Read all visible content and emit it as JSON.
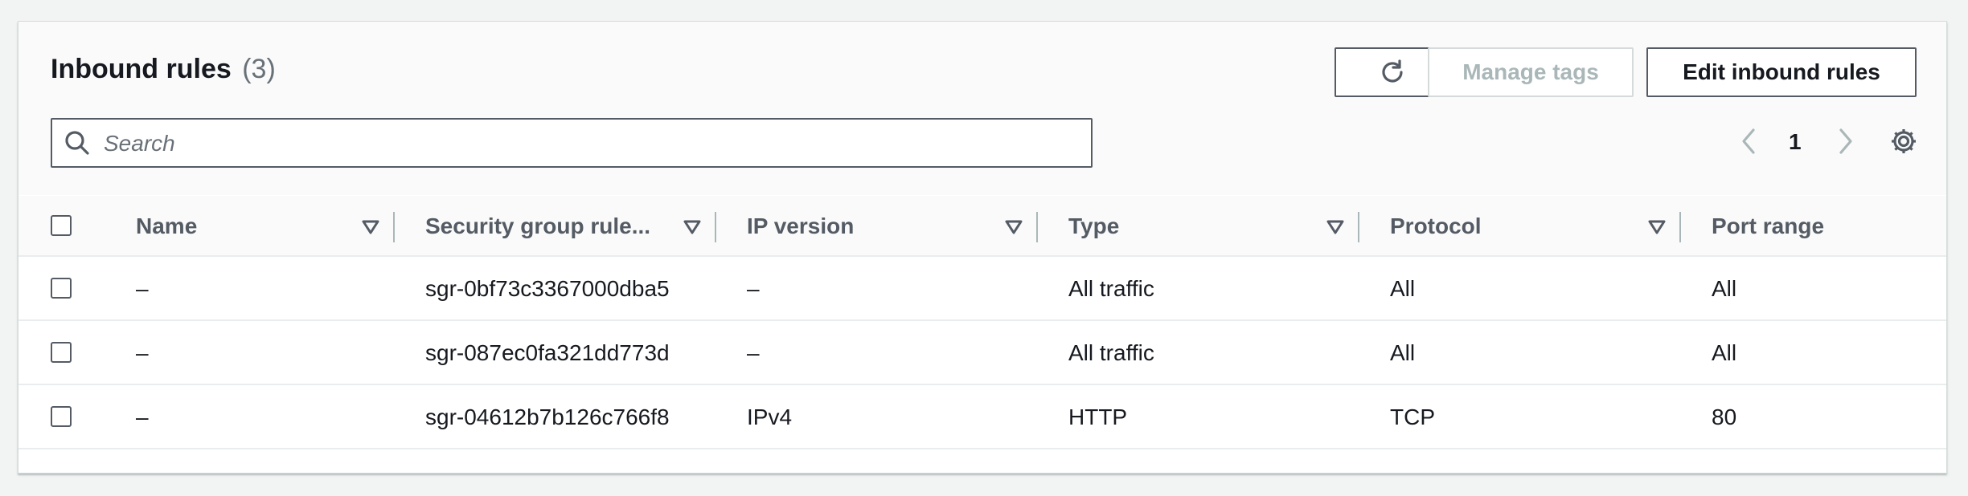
{
  "header": {
    "title": "Inbound rules",
    "count": "(3)",
    "buttons": {
      "manage_tags": "Manage tags",
      "edit_inbound_rules": "Edit inbound rules"
    }
  },
  "search": {
    "placeholder": "Search",
    "value": ""
  },
  "pagination": {
    "current_page": "1"
  },
  "table": {
    "columns": [
      "Name",
      "Security group rule...",
      "IP version",
      "Type",
      "Protocol",
      "Port range"
    ],
    "rows": [
      {
        "name": "–",
        "rule_id": "sgr-0bf73c3367000dba5",
        "ip_version": "–",
        "type": "All traffic",
        "protocol": "All",
        "port_range": "All"
      },
      {
        "name": "–",
        "rule_id": "sgr-087ec0fa321dd773d",
        "ip_version": "–",
        "type": "All traffic",
        "protocol": "All",
        "port_range": "All"
      },
      {
        "name": "–",
        "rule_id": "sgr-04612b7b126c766f8",
        "ip_version": "IPv4",
        "type": "HTTP",
        "protocol": "TCP",
        "port_range": "80"
      }
    ]
  },
  "icons": {
    "refresh": "refresh-icon",
    "search": "search-icon",
    "prev": "chevron-left-icon",
    "next": "chevron-right-icon",
    "settings": "gear-icon",
    "sort": "sort-caret-icon"
  },
  "colors": {
    "text": "#16191f",
    "muted": "#687078",
    "disabled": "#aab7b8",
    "border": "#545b64",
    "panel_bg": "#fafafa"
  }
}
